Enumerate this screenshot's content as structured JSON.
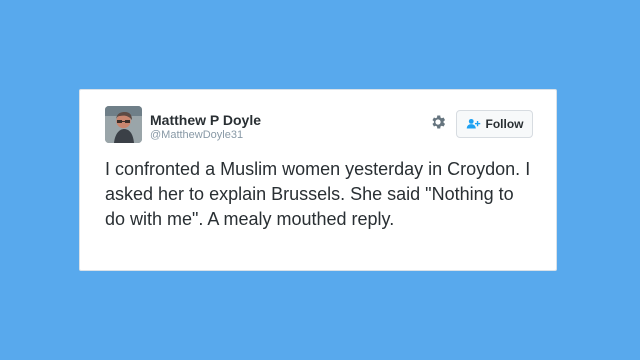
{
  "tweet": {
    "author": {
      "name": "Matthew P Doyle",
      "handle": "@MatthewDoyle31"
    },
    "follow_label": "Follow",
    "text": "I confronted a Muslim women yesterday in Croydon. I asked her to explain Brussels. She said \"Nothing to do with me\". A mealy mouthed reply."
  },
  "icons": {
    "settings": "gear-icon",
    "follow": "add-user-icon"
  },
  "colors": {
    "page_background": "#58a9ed",
    "accent": "#1da1f2"
  }
}
